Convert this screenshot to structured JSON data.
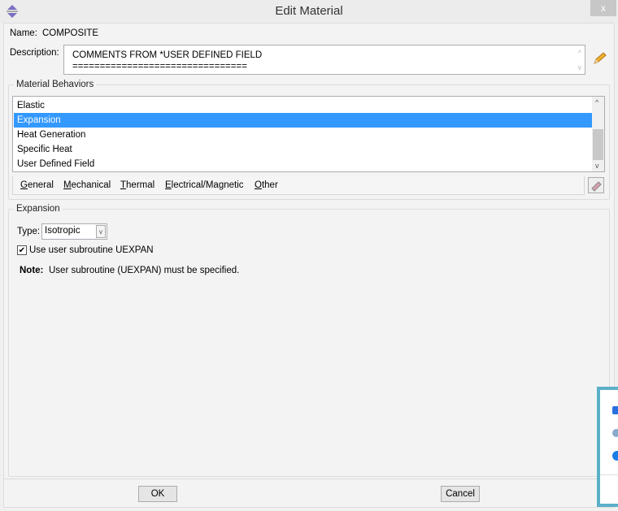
{
  "window": {
    "title": "Edit Material",
    "close_label": "x"
  },
  "name_label": "Name:",
  "name_value": "COMPOSITE",
  "description": {
    "label": "Description:",
    "lines": [
      "COMMENTS FROM *USER DEFINED FIELD",
      "================================"
    ]
  },
  "behaviors": {
    "legend": "Material Behaviors",
    "items": [
      "Elastic",
      "Expansion",
      "Heat Generation",
      "Specific Heat",
      "User Defined Field"
    ],
    "selected": "Expansion"
  },
  "menu": [
    "General",
    "Mechanical",
    "Thermal",
    "Electrical/Magnetic",
    "Other"
  ],
  "expansion": {
    "legend": "Expansion",
    "type_label": "Type:",
    "type_value": "Isotropic",
    "checkbox_label": "Use user subroutine UEXPAN",
    "checked": true,
    "note_label": "Note:",
    "note_text": "User subroutine (UEXPAN) must be specified."
  },
  "buttons": {
    "ok": "OK",
    "cancel": "Cancel"
  },
  "colors": {
    "selection": "#3399ff",
    "popup_border": "#5bb0c8"
  }
}
